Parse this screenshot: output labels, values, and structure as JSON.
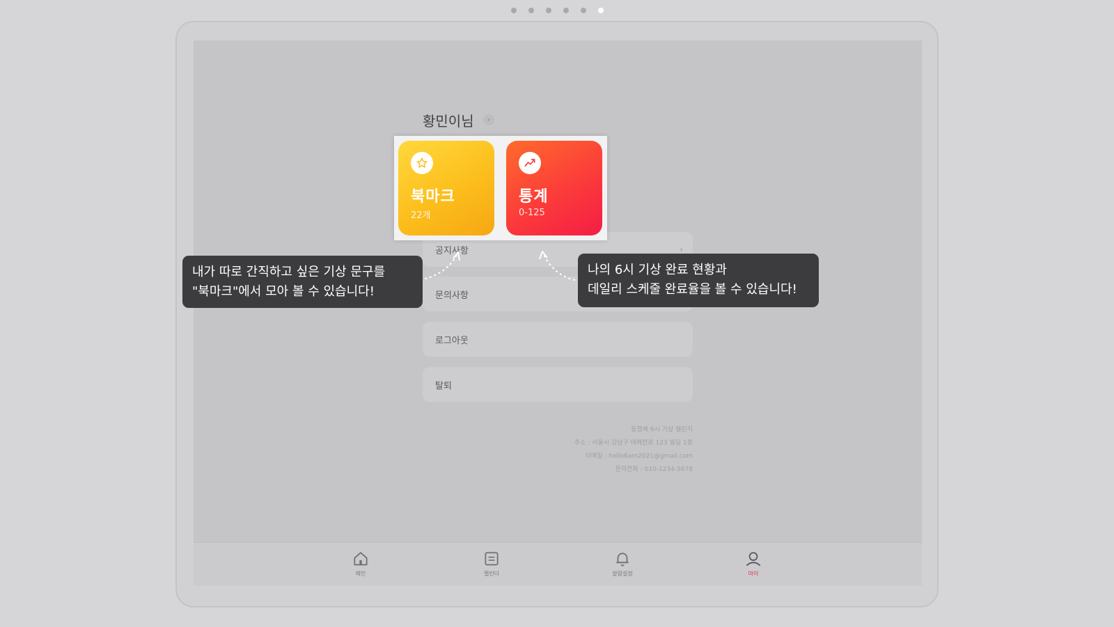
{
  "pager": {
    "total": 6,
    "active_index": 5
  },
  "user": {
    "name": "황민이님",
    "chevron": "›"
  },
  "cards": {
    "bookmark": {
      "title": "북마크",
      "subtitle": "22개",
      "icon": "bookmark-icon",
      "color": "#fcbe1c"
    },
    "stats": {
      "title": "통계",
      "subtitle": "0-125",
      "icon": "trend-chart-icon",
      "color": "#fb3c3a"
    }
  },
  "menu": {
    "items": [
      {
        "label": "공지사항",
        "chevron": "›"
      },
      {
        "label": "문의사항"
      },
      {
        "label": "로그아웃"
      },
      {
        "label": "탈퇴"
      }
    ]
  },
  "footer": {
    "lines": [
      "동행해 6시 기상 챌린지",
      "주소 : 서울시 강남구 테헤란로 123 빌딩 1층",
      "이메일 : hello6am2021@gmail.com",
      "문의전화 : 010-1234-5678"
    ]
  },
  "tooltips": {
    "bookmark": {
      "line1": "내가 따로 간직하고 싶은 기상 문구를",
      "line2": "\"북마크\"에서 모아 볼 수 있습니다!"
    },
    "stats": {
      "line1": "나의 6시 기상 완료 현황과",
      "line2": "데일리 스케줄 완료율을 볼 수 있습니다!"
    }
  },
  "tabbar": {
    "items": [
      {
        "label": "메인",
        "icon": "home-icon",
        "active": false
      },
      {
        "label": "캘린더",
        "icon": "calendar-icon",
        "active": false
      },
      {
        "label": "알람설정",
        "icon": "bell-icon",
        "active": false
      },
      {
        "label": "마이",
        "icon": "profile-icon",
        "active": true
      }
    ]
  },
  "colors": {
    "accent": "#d8374a",
    "tooltip_bg": "#3c3c3e"
  }
}
